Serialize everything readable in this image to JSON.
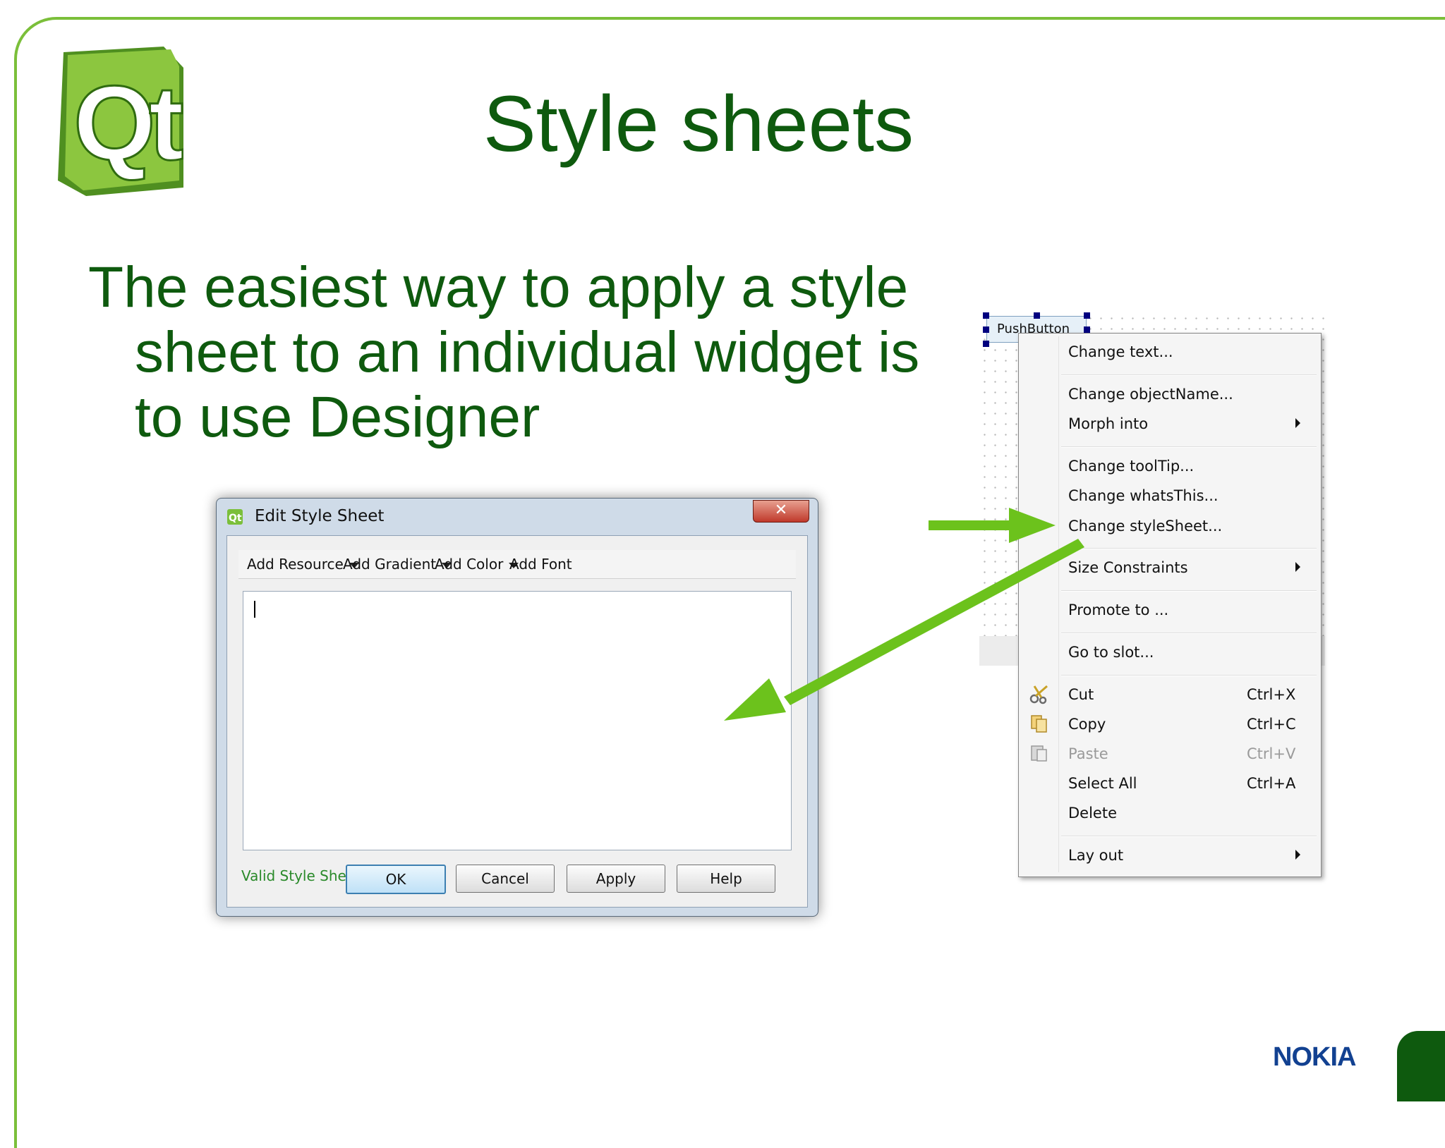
{
  "slide": {
    "title": "Style sheets",
    "body_lines": [
      "The easiest way to apply a style",
      "sheet to an individual widget is",
      "to use Designer"
    ],
    "logo_text": "Qt",
    "brand": "NOKIA"
  },
  "colors": {
    "title_green": "#0e5a0e",
    "accent_green": "#7bbf3a",
    "arrow_green": "#6cc21c",
    "nokia_blue": "#124191"
  },
  "dialog": {
    "title": "Edit Style Sheet",
    "close_glyph": "✕",
    "toolbar": {
      "add_resource": "Add Resource",
      "add_gradient": "Add Gradient",
      "add_color": "Add Color",
      "add_font": "Add Font"
    },
    "editor_value": "",
    "status": "Valid Style Sheet",
    "buttons": {
      "ok": "OK",
      "cancel": "Cancel",
      "apply": "Apply",
      "help": "Help"
    }
  },
  "designer": {
    "pushbutton_label": "PushButton"
  },
  "context_menu": {
    "items": [
      {
        "label": "Change text..."
      },
      {
        "label": "Change objectName..."
      },
      {
        "label": "Morph into",
        "submenu": true
      },
      {
        "label": "Change toolTip..."
      },
      {
        "label": "Change whatsThis..."
      },
      {
        "label": "Change styleSheet..."
      },
      {
        "label": "Size Constraints",
        "submenu": true
      },
      {
        "label": "Promote to ..."
      },
      {
        "label": "Go to slot..."
      },
      {
        "label": "Cut",
        "shortcut": "Ctrl+X",
        "icon": "scissors-icon"
      },
      {
        "label": "Copy",
        "shortcut": "Ctrl+C",
        "icon": "copy-icon"
      },
      {
        "label": "Paste",
        "shortcut": "Ctrl+V",
        "icon": "paste-icon",
        "disabled": true
      },
      {
        "label": "Select All",
        "shortcut": "Ctrl+A"
      },
      {
        "label": "Delete"
      },
      {
        "label": "Lay out",
        "submenu": true
      }
    ]
  }
}
